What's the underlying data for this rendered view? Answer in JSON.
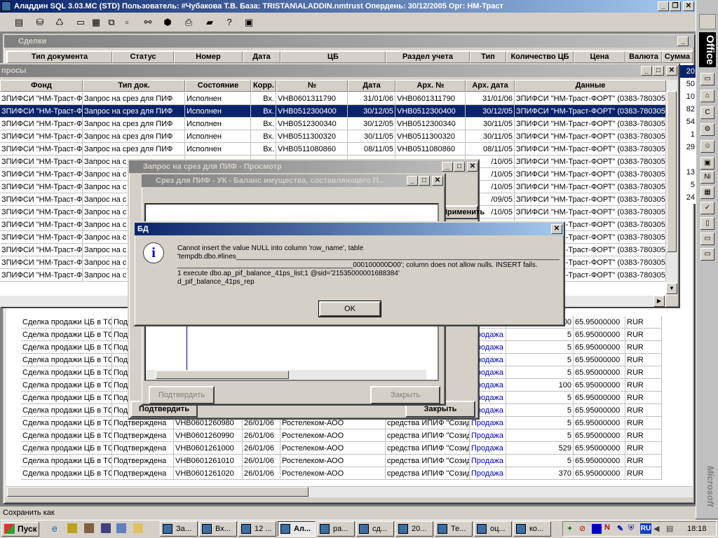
{
  "app": {
    "title": "Аладдин SQL 3.03.МС (STD)  Пользователь: #Чубакова Т.В. База: TRISTAN\\ALADDIN.nmtrust Опердень: 30/12/2005 Орг: НМ-Траст",
    "status": "Сохранить как"
  },
  "deals": {
    "title": "Сделки",
    "headers": [
      "Тип документа",
      "Статус",
      "Номер",
      "Дата",
      "ЦБ",
      "Раздел учета",
      "Тип",
      "Количество ЦБ",
      "Цена",
      "Валюта",
      "Сумма"
    ],
    "rows": [
      {
        "c1": "Сделка продажи ЦБ в ТС",
        "c2": "Подтверждена",
        "c3": "",
        "c4": "",
        "c5": "",
        "c6": "",
        "c7": "",
        "c8": "100",
        "c9": "65.95000000",
        "c10": "RUR"
      },
      {
        "c1": "Сделка продажи ЦБ в ТС",
        "c2": "Подтверждена",
        "c3": "",
        "c4": "",
        "c5": "",
        "c6": "",
        "c7": "Продажа",
        "c8": "5",
        "c9": "65.95000000",
        "c10": "RUR"
      },
      {
        "c1": "Сделка продажи ЦБ в ТС",
        "c2": "Подтверждена",
        "c3": "",
        "c4": "",
        "c5": "",
        "c6": "",
        "c7": "Продажа",
        "c8": "5",
        "c9": "65.95000000",
        "c10": "RUR"
      },
      {
        "c1": "Сделка продажи ЦБ в ТС",
        "c2": "Подтверждена",
        "c3": "",
        "c4": "",
        "c5": "",
        "c6": "",
        "c7": "Продажа",
        "c8": "5",
        "c9": "65.95000000",
        "c10": "RUR"
      },
      {
        "c1": "Сделка продажи ЦБ в ТС",
        "c2": "Подтверждена",
        "c3": "",
        "c4": "",
        "c5": "",
        "c6": "",
        "c7": "Продажа",
        "c8": "5",
        "c9": "65.95000000",
        "c10": "RUR"
      },
      {
        "c1": "Сделка продажи ЦБ в ТС",
        "c2": "Подтверждена",
        "c3": "",
        "c4": "",
        "c5": "",
        "c6": "",
        "c7": "Продажа",
        "c8": "100",
        "c9": "65.95000000",
        "c10": "RUR"
      },
      {
        "c1": "Сделка продажи ЦБ в ТС",
        "c2": "Подтверждена",
        "c3": "",
        "c4": "",
        "c5": "",
        "c6": "",
        "c7": "Продажа",
        "c8": "5",
        "c9": "65.95000000",
        "c10": "RUR"
      },
      {
        "c1": "Сделка продажи ЦБ в ТС",
        "c2": "Подтверждена",
        "c3": "",
        "c4": "",
        "c5": "",
        "c6": "",
        "c7": "Продажа",
        "c8": "5",
        "c9": "65.95000000",
        "c10": "RUR"
      },
      {
        "c1": "Сделка продажи ЦБ в ТС",
        "c2": "Подтверждена",
        "c3": "VHB0601260980",
        "c4": "26/01/06",
        "c5": "Ростелеком-АОО",
        "c6": "средства ИПИФ \"Созид",
        "c7": "Продажа",
        "c8": "5",
        "c9": "65.95000000",
        "c10": "RUR"
      },
      {
        "c1": "Сделка продажи ЦБ в ТС",
        "c2": "Подтверждена",
        "c3": "VHB0601260990",
        "c4": "26/01/06",
        "c5": "Ростелеком-АОО",
        "c6": "средства ИПИФ \"Созид",
        "c7": "Продажа",
        "c8": "5",
        "c9": "65.95000000",
        "c10": "RUR"
      },
      {
        "c1": "Сделка продажи ЦБ в ТС",
        "c2": "Подтверждена",
        "c3": "VHB0601261000",
        "c4": "26/01/06",
        "c5": "Ростелеком-АОО",
        "c6": "средства ИПИФ \"Созид",
        "c7": "Продажа",
        "c8": "529",
        "c9": "65.95000000",
        "c10": "RUR"
      },
      {
        "c1": "Сделка продажи ЦБ в ТС",
        "c2": "Подтверждена",
        "c3": "VHB0601261010",
        "c4": "26/01/06",
        "c5": "Ростелеком-АОО",
        "c6": "средства ИПИФ \"Созид",
        "c7": "Продажа",
        "c8": "5",
        "c9": "65.95000000",
        "c10": "RUR"
      },
      {
        "c1": "Сделка продажи ЦБ в ТС",
        "c2": "Подтверждена",
        "c3": "VHB0601261020",
        "c4": "26/01/06",
        "c5": "Ростелеком-АОО",
        "c6": "средства ИПИФ \"Созид",
        "c7": "Продажа",
        "c8": "370",
        "c9": "65.95000000",
        "c10": "RUR"
      }
    ],
    "sum_col": [
      "20",
      "50",
      "10",
      "82",
      "54",
      "1",
      "29",
      "",
      "13",
      "5",
      "24"
    ]
  },
  "requests": {
    "title": "просы",
    "headers": [
      "Фонд",
      "Тип док.",
      "Состояние",
      "Корр.",
      "№",
      "Дата",
      "Арх. №",
      "Арх. дата",
      "Данные"
    ],
    "rows": [
      {
        "c1": "ЗПИФСИ \"НМ-Траст-Ф",
        "c2": "Запрос на срез для ПИФ",
        "c3": "Исполнен",
        "c4": "Вх.",
        "c5": "VHB0601311790",
        "c6": "31/01/06",
        "c7": "VHB0601311790",
        "c8": "31/01/06",
        "c9": "ЗПИФСИ \"НМ-Траст-ФОРТ\" (0383-780305"
      },
      {
        "c1": "ЗПИФСИ \"НМ-Траст-Ф",
        "c2": "Запрос на срез для ПИФ",
        "c3": "Исполнен",
        "c4": "Вх.",
        "c5": "VHB0512300400",
        "c6": "30/12/05",
        "c7": "VHB0512300400",
        "c8": "30/12/05",
        "c9": "ЗПИФСИ \"НМ-Траст-ФОРТ\" (0383-780305"
      },
      {
        "c1": "ЗПИФСИ \"НМ-Траст-Ф",
        "c2": "Запрос на срез для ПИФ",
        "c3": "Исполнен",
        "c4": "Вх.",
        "c5": "VHB0512300340",
        "c6": "30/12/05",
        "c7": "VHB0512300340",
        "c8": "30/11/05",
        "c9": "ЗПИФСИ \"НМ-Траст-ФОРТ\" (0383-780305"
      },
      {
        "c1": "ЗПИФСИ \"НМ-Траст-Ф",
        "c2": "Запрос на срез для ПИФ",
        "c3": "Исполнен",
        "c4": "Вх.",
        "c5": "VHB0511300320",
        "c6": "30/11/05",
        "c7": "VHB0511300320",
        "c8": "30/11/05",
        "c9": "ЗПИФСИ \"НМ-Траст-ФОРТ\" (0383-780305"
      },
      {
        "c1": "ЗПИФСИ \"НМ-Траст-Ф",
        "c2": "Запрос на срез для ПИФ",
        "c3": "Исполнен",
        "c4": "Вх.",
        "c5": "VHB0511080860",
        "c6": "08/11/05",
        "c7": "VHB0511080860",
        "c8": "08/11/05",
        "c9": "ЗПИФСИ \"НМ-Траст-ФОРТ\" (0383-780305"
      },
      {
        "c1": "ЗПИФСИ \"НМ-Траст-Ф",
        "c2": "Запрос на с",
        "c8": "/10/05",
        "c9": "ЗПИФСИ \"НМ-Траст-ФОРТ\" (0383-780305"
      },
      {
        "c1": "ЗПИФСИ \"НМ-Траст-Ф",
        "c2": "Запрос на с",
        "c8": "/10/05",
        "c9": "ЗПИФСИ \"НМ-Траст-ФОРТ\" (0383-780305"
      },
      {
        "c1": "ЗПИФСИ \"НМ-Траст-Ф",
        "c2": "Запрос на с",
        "c8": "/10/05",
        "c9": "ЗПИФСИ \"НМ-Траст-ФОРТ\" (0383-780305"
      },
      {
        "c1": "ЗПИФСИ \"НМ-Траст-Ф",
        "c2": "Запрос на с",
        "c8": "/09/05",
        "c9": "ЗПИФСИ \"НМ-Траст-ФОРТ\" (0383-780305"
      },
      {
        "c1": "ЗПИФСИ \"НМ-Траст-Ф",
        "c2": "Запрос на с",
        "c8": "/10/05",
        "c9": "ЗПИФСИ \"НМ-Траст-ФОРТ\" (0383-780305"
      },
      {
        "c1": "ЗПИФСИ \"НМ-Траст-Ф",
        "c2": "Запрос на с",
        "c8": "",
        "c9": "ЗПИФСИ \"НМ-Траст-ФОРТ\" (0383-780305"
      },
      {
        "c1": "ЗПИФСИ \"НМ-Траст-Ф",
        "c2": "Запрос на с",
        "c8": "",
        "c9": "ЗПИФСИ \"НМ-Траст-ФОРТ\" (0383-780305"
      },
      {
        "c1": "ЗПИФСИ \"НМ-Траст-Ф",
        "c2": "Запрос на с",
        "c8": "",
        "c9": "ЗПИФСИ \"НМ-Траст-ФОРТ\" (0383-780305"
      },
      {
        "c1": "ЗПИФСИ \"НМ-Траст-Ф",
        "c2": "Запрос на с",
        "c8": "",
        "c9": "ЗПИФСИ \"НМ-Траст-ФОРТ\" (0383-780305"
      },
      {
        "c1": "ЗПИФСИ \"НМ-Траст-Ф",
        "c2": "Запрос на с",
        "c8": "",
        "c9": "ЗПИФСИ \"НМ-Траст-ФОРТ\" (0383-780305"
      }
    ]
  },
  "view": {
    "title": "Запрос на срез для ПИФ - Просмотр",
    "btn_confirm": "Подтвердить",
    "btn_close": "Закрыть",
    "btn_apply": "Применить"
  },
  "inner": {
    "title": "Срез для ПИФ - УК - Баланс имущества, составляющего П...",
    "btn_confirm": "Подтвердить",
    "btn_close": "Закрыть"
  },
  "error": {
    "title": "БД",
    "line1": "Cannot insert the value NULL into column 'row_name', table",
    "line2": "'tempdb.dbo.#lines_____________________________________________________________________________________________",
    "line3": "_____________________________________________000100000D00'; column does not allow nulls. INSERT fails.",
    "line4": "1 execute dbo.ap_pif_balance_41ps_list;1 @sid='21535000001688384'",
    "line5": "d_pif_balance_41ps_rep",
    "ok": "OK"
  },
  "taskbar": {
    "start": "Пуск",
    "clock": "18:18",
    "buttons": [
      "За...",
      "Вх...",
      "12 ...",
      "Ал...",
      "ра...",
      "сд...",
      "20...",
      "Те...",
      "оц...",
      "ко..."
    ],
    "lang": "RU"
  },
  "office": {
    "brand": "Office",
    "vendor": "Microsoft"
  }
}
